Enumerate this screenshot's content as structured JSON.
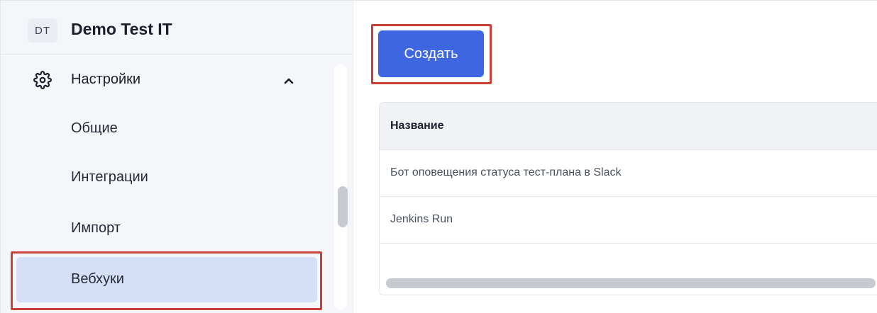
{
  "project": {
    "avatar": "DT",
    "name": "Demo Test IT"
  },
  "sidebar": {
    "section": {
      "icon": "gear-icon",
      "label": "Настройки",
      "chevron": "chevron-up-icon"
    },
    "items": [
      {
        "label": "Общие",
        "active": false
      },
      {
        "label": "Интеграции",
        "active": false
      },
      {
        "label": "Импорт",
        "active": false
      },
      {
        "label": "Вебхуки",
        "active": true
      }
    ]
  },
  "toolbar": {
    "create_label": "Создать"
  },
  "table": {
    "columns": [
      "Название"
    ],
    "rows": [
      [
        "Бот оповещения статуса тест-плана в Slack"
      ],
      [
        "Jenkins Run"
      ],
      [
        ""
      ]
    ]
  },
  "colors": {
    "accent": "#3d66e0",
    "active_item_bg": "#d5dff7",
    "highlight_border": "#c94136",
    "sidebar_bg": "#f5f6fa"
  }
}
